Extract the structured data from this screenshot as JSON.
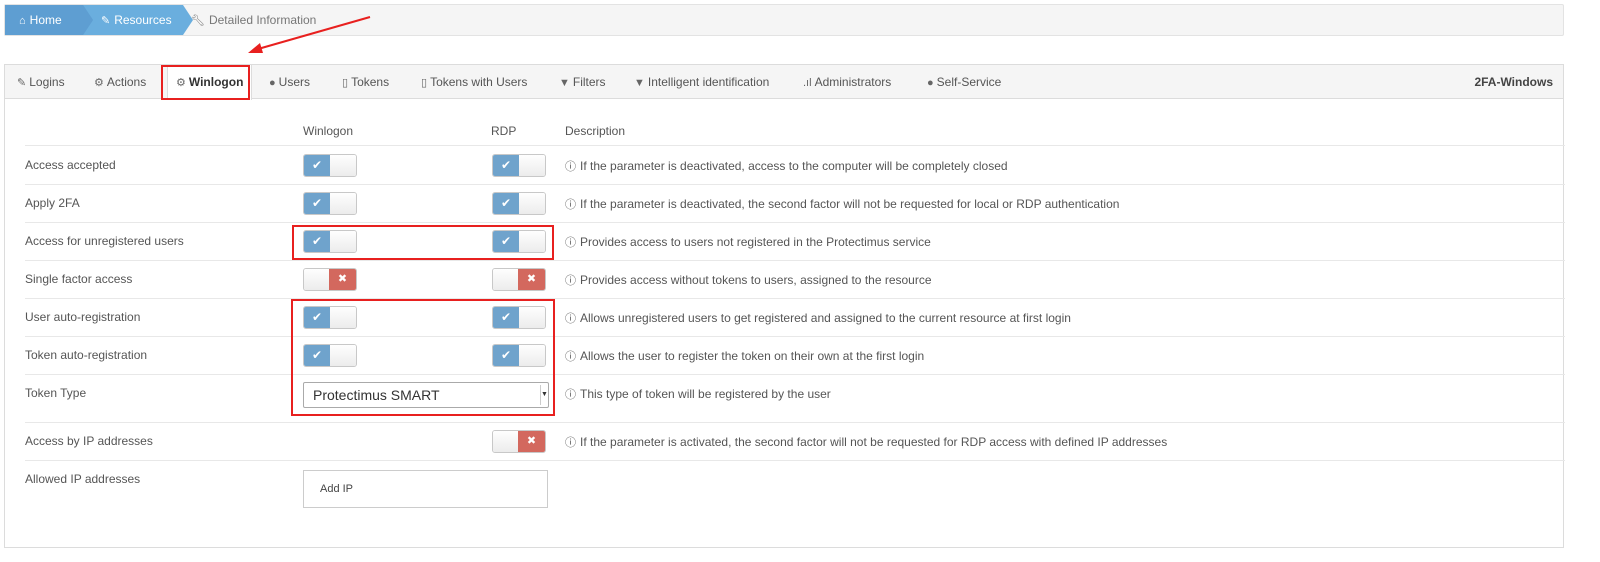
{
  "breadcrumb": {
    "home": "Home",
    "resources": "Resources",
    "detail": "Detailed Information"
  },
  "tabs": [
    {
      "label": "Logins",
      "icon": "edit-icon"
    },
    {
      "label": "Actions",
      "icon": "gears-icon"
    },
    {
      "label": "Winlogon",
      "icon": "gear-icon",
      "active": true
    },
    {
      "label": "Users",
      "icon": "user-icon"
    },
    {
      "label": "Tokens",
      "icon": "mobile-icon"
    },
    {
      "label": "Tokens with Users",
      "icon": "mobile-icon"
    },
    {
      "label": "Filters",
      "icon": "filter-icon"
    },
    {
      "label": "Intelligent identification",
      "icon": "filter-icon"
    },
    {
      "label": "Administrators",
      "icon": "signal-icon"
    },
    {
      "label": "Self-Service",
      "icon": "user-tie-icon"
    }
  ],
  "resource_name": "2FA-Windows",
  "table": {
    "headers": {
      "winlogon": "Winlogon",
      "rdp": "RDP",
      "description": "Description"
    },
    "rows": [
      {
        "label": "Access accepted",
        "winlogon": "on",
        "rdp": "on",
        "description": "If the parameter is deactivated, access to the computer will be completely closed"
      },
      {
        "label": "Apply 2FA",
        "winlogon": "on",
        "rdp": "on",
        "description": "If the parameter is deactivated, the second factor will not be requested for local or RDP authentication"
      },
      {
        "label": "Access for unregistered users",
        "winlogon": "on",
        "rdp": "on",
        "description": "Provides access to users not registered in the Protectimus service"
      },
      {
        "label": "Single factor access",
        "winlogon": "off",
        "rdp": "off",
        "description": "Provides access without tokens to users, assigned to the resource"
      },
      {
        "label": "User auto-registration",
        "winlogon": "on",
        "rdp": "on",
        "description": "Allows unregistered users to get registered and assigned to the current resource at first login"
      },
      {
        "label": "Token auto-registration",
        "winlogon": "on",
        "rdp": "on",
        "description": "Allows the user to register the token on their own at the first login"
      },
      {
        "label": "Token Type",
        "select_value": "Protectimus SMART",
        "description": "This type of token will be registered by the user"
      },
      {
        "label": "Access by IP addresses",
        "rdp": "off",
        "description": "If the parameter is activated, the second factor will not be requested for RDP access with defined IP addresses"
      },
      {
        "label": "Allowed IP addresses",
        "button": "Add IP"
      }
    ]
  },
  "toggle_glyphs": {
    "on": "✔",
    "off": "✖"
  },
  "colors": {
    "primary": "#5e9ed2",
    "toggle_on": "#6fa3cc",
    "toggle_off": "#d3685e",
    "annotation": "#e8201f"
  }
}
